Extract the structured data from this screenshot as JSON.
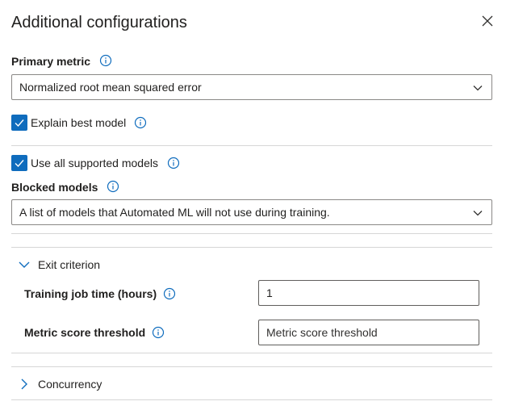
{
  "panel": {
    "title": "Additional configurations"
  },
  "primary_metric": {
    "label": "Primary metric",
    "value": "Normalized root mean squared error"
  },
  "explain_best_model": {
    "label": "Explain best model",
    "checked": true
  },
  "use_all_supported_models": {
    "label": "Use all supported models",
    "checked": true
  },
  "blocked_models": {
    "label": "Blocked models",
    "value": "A list of models that Automated ML will not use during training."
  },
  "exit_criterion": {
    "label": "Exit criterion",
    "expanded": true,
    "training_job_time": {
      "label": "Training job time (hours)",
      "value": "1"
    },
    "metric_score_threshold": {
      "label": "Metric score threshold",
      "placeholder": "Metric score threshold"
    }
  },
  "concurrency": {
    "label": "Concurrency",
    "expanded": false
  },
  "colors": {
    "accent": "#0f6cbd",
    "divider": "#d6d6d6",
    "text": "#201f1e"
  }
}
